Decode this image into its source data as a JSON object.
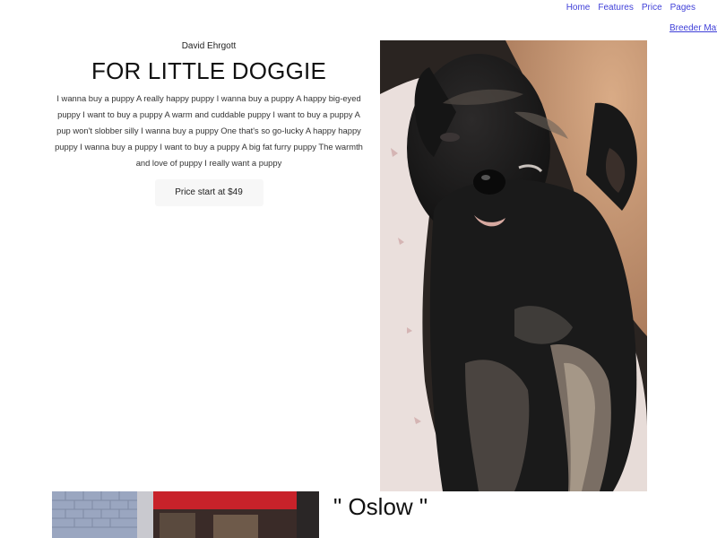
{
  "nav": {
    "items": [
      "Home",
      "Features",
      "Price",
      "Pages"
    ],
    "extra": "Breeder Mate"
  },
  "hero": {
    "author": "David Ehrgott",
    "title": "FOR LITTLE DOGGIE",
    "description": "I wanna buy a puppy A really happy puppy I wanna buy a puppy A happy big-eyed puppy I want to buy a puppy A warm and cuddable puppy I want to buy a puppy A pup won't slobber silly I wanna buy a puppy One that's so go-lucky A happy happy puppy I wanna buy a puppy I want to buy a puppy A big fat furry puppy The warmth and love of puppy I really want a puppy",
    "price_button": "Price start at $49"
  },
  "featured": {
    "name": "\" Oslow \""
  },
  "colors": {
    "link": "#3f3fd8",
    "button_bg": "#f7f7f7"
  }
}
